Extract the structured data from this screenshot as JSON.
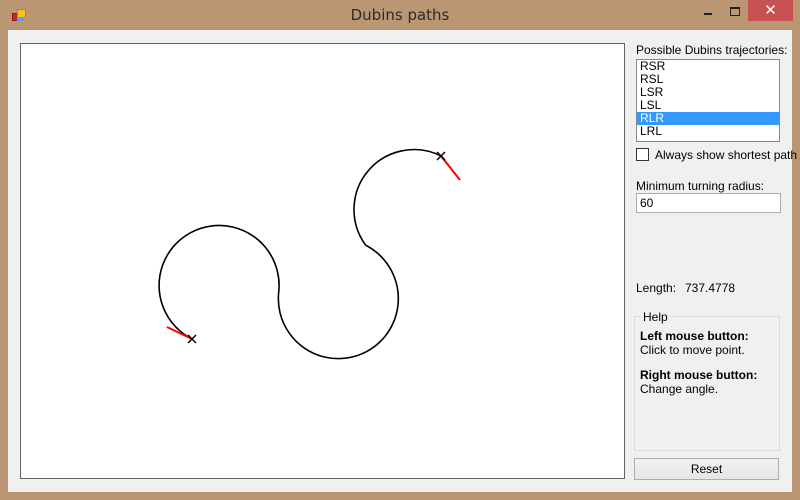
{
  "window": {
    "title": "Dubins paths",
    "icons": {
      "app": "app-icon",
      "minimize": "minimize-icon",
      "maximize": "maximize-icon",
      "close": "close-icon"
    },
    "close_glyph": "✕"
  },
  "sidebar": {
    "trajectories_label": "Possible Dubins trajectories:",
    "trajectories": [
      {
        "label": "RSR",
        "selected": false
      },
      {
        "label": "RSL",
        "selected": false
      },
      {
        "label": "LSR",
        "selected": false
      },
      {
        "label": "LSL",
        "selected": false
      },
      {
        "label": "RLR",
        "selected": true
      },
      {
        "label": "LRL",
        "selected": false
      }
    ],
    "shortest_checkbox": {
      "label": "Always show shortest path",
      "checked": false
    },
    "radius_label": "Minimum turning radius:",
    "radius_value": "60",
    "length_label": "Length:",
    "length_value": "737.4778",
    "help": {
      "title": "Help",
      "left_bold": "Left mouse button:",
      "left_text": " Click to move point.",
      "right_bold": "Right mouse button:",
      "right_text": "Change angle."
    },
    "reset_label": "Reset"
  },
  "canvas": {
    "path_type": "RLR",
    "turning_radius": 60,
    "path_color": "#000000",
    "heading_color": "#ff0000",
    "start_marker": "start-point",
    "end_marker": "end-point"
  }
}
